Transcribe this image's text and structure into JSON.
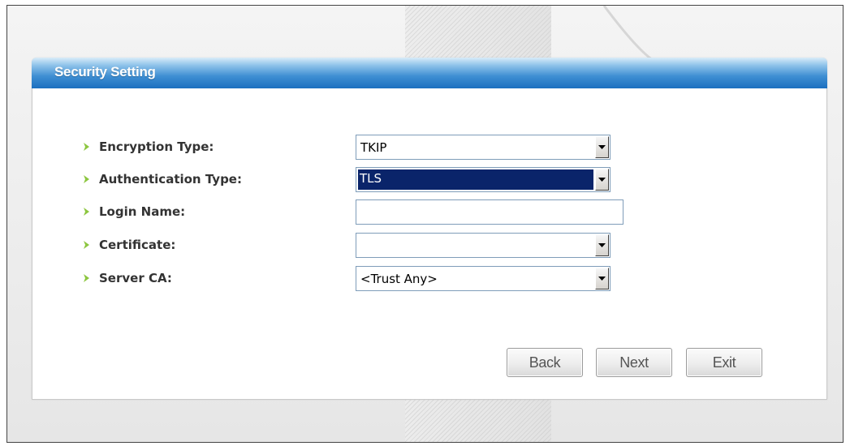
{
  "panel": {
    "title": "Security Setting"
  },
  "form": {
    "encryption_type": {
      "label": "Encryption Type:",
      "value": "TKIP"
    },
    "authentication_type": {
      "label": "Authentication Type:",
      "value": "TLS"
    },
    "login_name": {
      "label": "Login Name:",
      "value": ""
    },
    "certificate": {
      "label": "Certificate:",
      "value": ""
    },
    "server_ca": {
      "label": "Server CA:",
      "value": "<Trust Any>"
    }
  },
  "buttons": {
    "back": "Back",
    "next": "Next",
    "exit": "Exit"
  },
  "icons": {
    "bullet": "green-arrow-bullet-icon",
    "dropdown": "dropdown-arrow-icon"
  },
  "colors": {
    "header_blue": "#1b6fbf",
    "bullet_green": "#8cc63f",
    "selection": "#0a246a"
  }
}
